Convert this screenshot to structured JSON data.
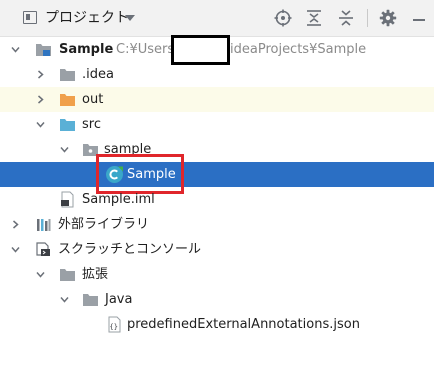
{
  "toolbar": {
    "title": "プロジェクト",
    "icons": [
      "view-mode-icon",
      "locate-icon",
      "expand-all-icon",
      "collapse-all-icon",
      "settings-gear-icon",
      "hide-minimize-icon"
    ]
  },
  "tree": {
    "root": {
      "label": "Sample",
      "path_prefix": "C:¥Users",
      "path_suffix": "ideaProjects¥Sample"
    },
    "items": [
      {
        "label": ".idea"
      },
      {
        "label": "out"
      },
      {
        "label": "src"
      },
      {
        "label": "sample"
      },
      {
        "label": "Sample"
      },
      {
        "label": "Sample.iml"
      },
      {
        "label": "外部ライブラリ"
      },
      {
        "label": "スクラッチとコンソール"
      },
      {
        "label": "拡張"
      },
      {
        "label": "Java"
      },
      {
        "label": "predefinedExternalAnnotations.json"
      }
    ]
  },
  "colors": {
    "selection": "#2b6fc4",
    "highlight_row": "#fcfbe9",
    "annotation_box": "#e0262b",
    "folder_out": "#f0a04b",
    "folder_src": "#5ab0d6",
    "folder_gray": "#9aa0a6",
    "class_icon": "#3aa7c9"
  }
}
